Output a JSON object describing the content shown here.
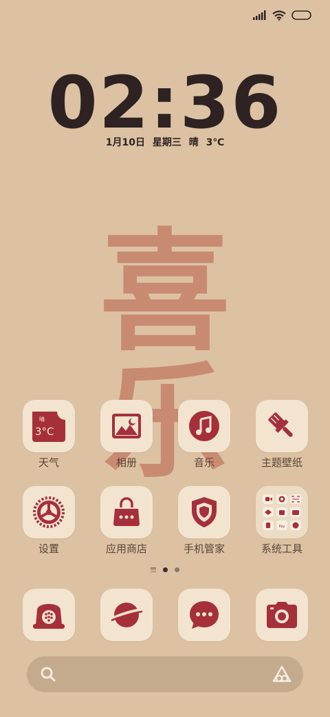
{
  "status_bar": {
    "icons": [
      "cellular-signal-icon",
      "wifi-icon",
      "battery-icon"
    ]
  },
  "clock": {
    "time": "02:36",
    "date": "1月10日 星期三 晴 3℃"
  },
  "wallpaper": {
    "calligraphy_char_1": "喜",
    "calligraphy_char_2": "乐",
    "colors": {
      "background": "#dcc2a2",
      "calligraphy": "#c98a72",
      "accent": "#a5303a",
      "tile": "#f3e4d0"
    }
  },
  "apps_row1": [
    {
      "label": "天气",
      "icon": "weather-icon",
      "weather_condition": "晴",
      "weather_temp": "3°C"
    },
    {
      "label": "相册",
      "icon": "gallery-icon"
    },
    {
      "label": "音乐",
      "icon": "music-icon"
    },
    {
      "label": "主题壁纸",
      "icon": "paintbrush-icon"
    }
  ],
  "apps_row2": [
    {
      "label": "设置",
      "icon": "settings-gear-icon"
    },
    {
      "label": "应用商店",
      "icon": "shopping-bag-icon"
    },
    {
      "label": "手机管家",
      "icon": "shield-icon"
    },
    {
      "label": "系统工具",
      "icon": "folder-icon"
    }
  ],
  "dock": [
    {
      "name": "phone",
      "icon": "rotary-phone-icon"
    },
    {
      "name": "browser",
      "icon": "planet-icon"
    },
    {
      "name": "messages",
      "icon": "chat-bubble-icon"
    },
    {
      "name": "camera",
      "icon": "camera-icon"
    }
  ],
  "page_indicator": {
    "pages": 2,
    "active": 1
  },
  "search_bar": {
    "icons": [
      "search-icon",
      "assistant-icon"
    ]
  }
}
